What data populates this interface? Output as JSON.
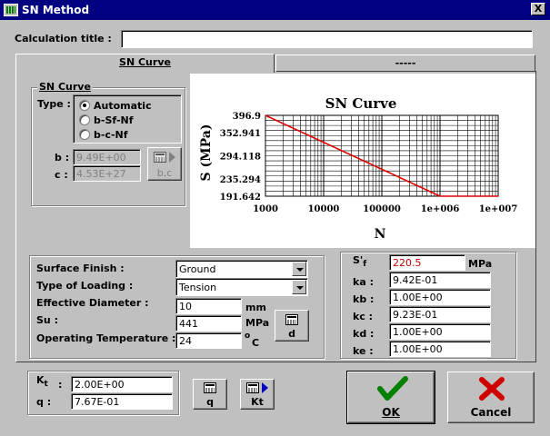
{
  "window": {
    "title": "SN Method",
    "close": "X"
  },
  "calc": {
    "label": "Calculation title :",
    "value": ""
  },
  "tabs": [
    {
      "label": "SN Curve"
    },
    {
      "label": "-----"
    }
  ],
  "sn_group": {
    "legend": "SN Curve",
    "type_label": "Type :",
    "options": [
      {
        "label": "Automatic",
        "checked": true
      },
      {
        "label": "b-Sf-Nf",
        "checked": false
      },
      {
        "label": "b-c-Nf",
        "checked": false
      }
    ],
    "b_label": "b :",
    "b_value": "9.49E+00",
    "c_label": "c :",
    "c_value": "4.53E+27",
    "bc_button": "b,c"
  },
  "chart_data": {
    "type": "line",
    "title": "SN Curve",
    "xlabel": "N",
    "ylabel": "S (MPa)",
    "xscale": "log",
    "xlim": [
      1000,
      10000000
    ],
    "ylim": [
      191.642,
      396.9
    ],
    "x_ticks": [
      "1000",
      "10000",
      "100000",
      "1e+006",
      "1e+007"
    ],
    "y_ticks": [
      "396.9",
      "352.941",
      "294.118",
      "235.294",
      "191.642"
    ],
    "grid": true,
    "color": "#e00000",
    "series": [
      {
        "x": [
          1000,
          1000000,
          10000000
        ],
        "y": [
          396.9,
          191.642,
          191.642
        ]
      }
    ]
  },
  "surface": {
    "label": "Surface Finish :",
    "value": "Ground",
    "loading_label": "Type of Loading :",
    "loading_value": "Tension",
    "diameter_label": "Effective Diameter :",
    "diameter_value": "10",
    "diameter_unit": "mm",
    "su_label": "Su :",
    "su_value": "441",
    "su_unit": "MPa",
    "temp_label": "Operating Temperature :",
    "temp_value": "24",
    "temp_unit": "C",
    "temp_deg": "o",
    "d_button": "d"
  },
  "factors": {
    "sf_label": "S'",
    "sf_sub": "f",
    "sf_value": "220.5",
    "sf_unit": "MPa",
    "sf_color": "#c00000",
    "rows": [
      {
        "label": "ka :",
        "value": "9.42E-01"
      },
      {
        "label": "kb :",
        "value": "1.00E+00"
      },
      {
        "label": "kc :",
        "value": "9.23E-01"
      },
      {
        "label": "kd :",
        "value": "1.00E+00"
      },
      {
        "label": "ke :",
        "value": "1.00E+00"
      }
    ]
  },
  "kt": {
    "label": "K",
    "sub": "t",
    "colon": ":",
    "value": "2.00E+00",
    "q_label": "q :",
    "q_value": "7.67E-01"
  },
  "buttons": {
    "q": "q",
    "kt": "Kt",
    "ok": "OK",
    "cancel": "Cancel"
  }
}
